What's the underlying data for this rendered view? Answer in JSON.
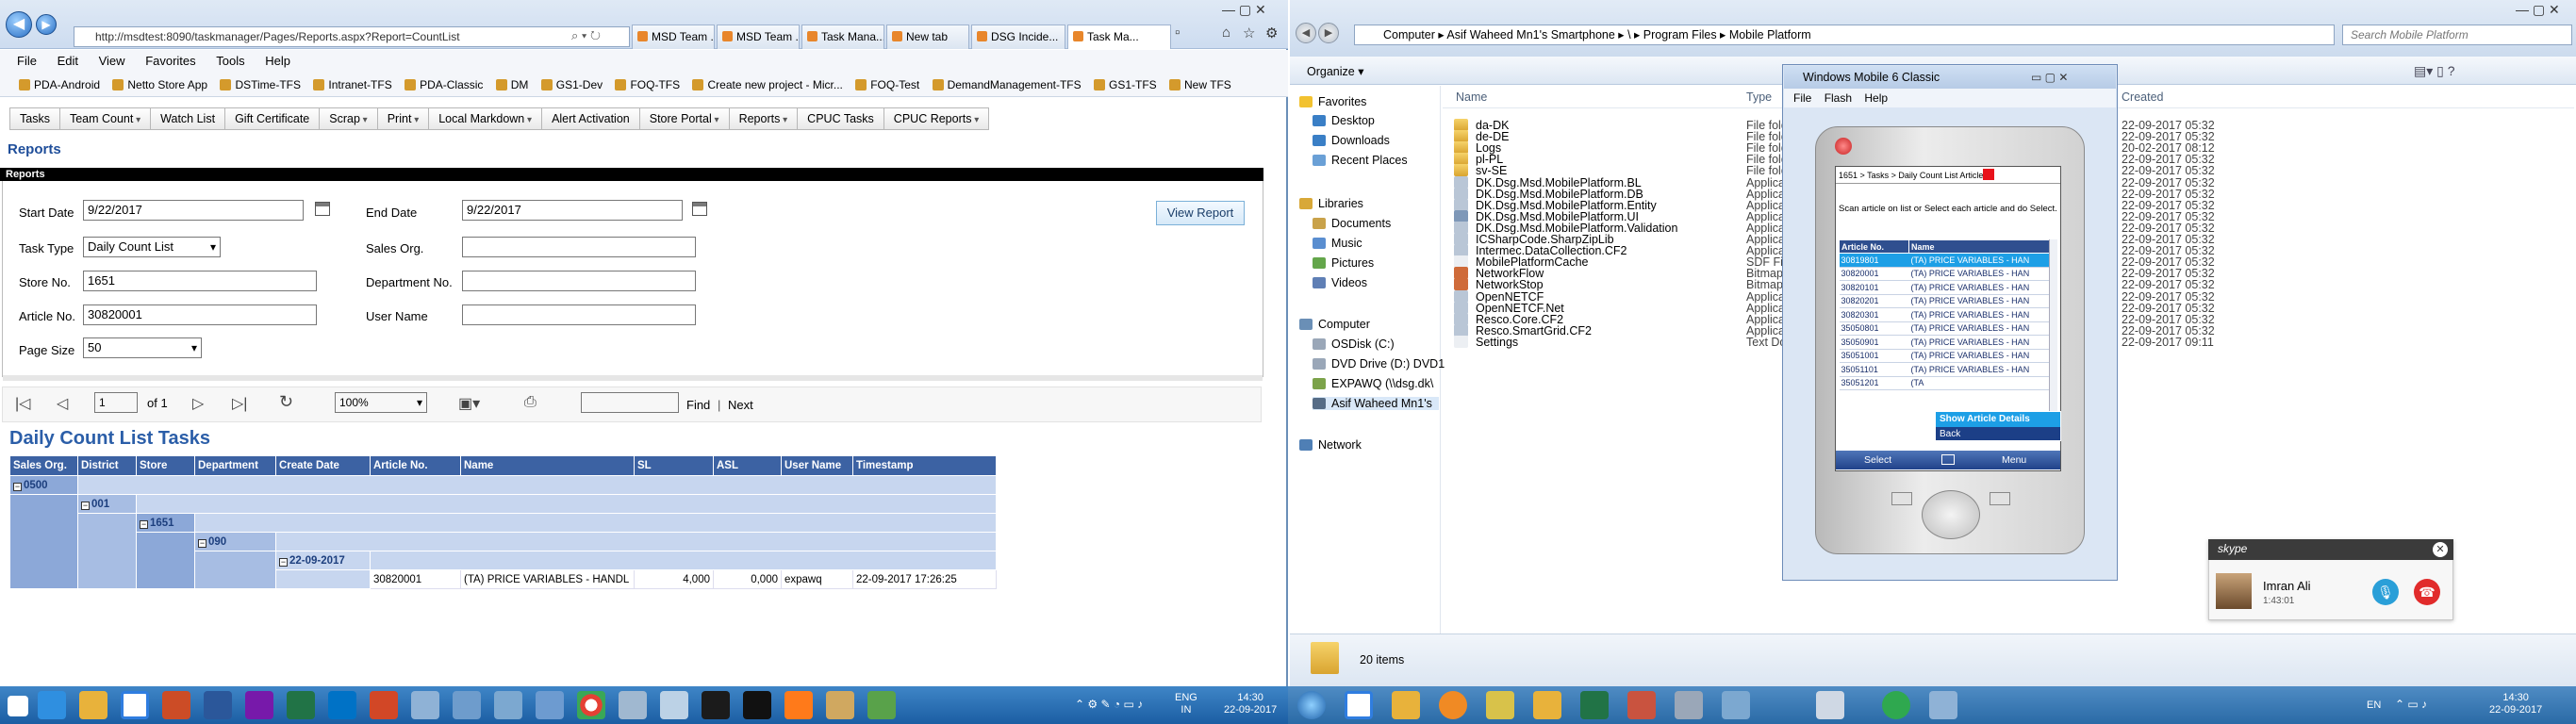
{
  "ie": {
    "url": "http://msdtest:8090/taskmanager/Pages/Reports.aspx?Report=CountList",
    "tabs": [
      "MSD Team ...",
      "MSD Team ...",
      "Task Mana...",
      "New tab",
      "DSG Incide...",
      "Task Ma..."
    ],
    "menu": [
      "File",
      "Edit",
      "View",
      "Favorites",
      "Tools",
      "Help"
    ],
    "favorites": [
      "PDA-Android",
      "Netto Store App",
      "DSTime-TFS",
      "Intranet-TFS",
      "PDA-Classic",
      "DM",
      "GS1-Dev",
      "FOQ-TFS",
      "Create new project - Micr...",
      "FOQ-Test",
      "DemandManagement-TFS",
      "GS1-TFS",
      "New TFS"
    ]
  },
  "appnav": [
    {
      "label": "Tasks",
      "dd": false
    },
    {
      "label": "Team Count",
      "dd": true
    },
    {
      "label": "Watch List",
      "dd": false
    },
    {
      "label": "Gift Certificate",
      "dd": false
    },
    {
      "label": "Scrap",
      "dd": true
    },
    {
      "label": "Print",
      "dd": true
    },
    {
      "label": "Local Markdown",
      "dd": true
    },
    {
      "label": "Alert Activation",
      "dd": false
    },
    {
      "label": "Store Portal",
      "dd": true
    },
    {
      "label": "Reports",
      "dd": true
    },
    {
      "label": "CPUC Tasks",
      "dd": false
    },
    {
      "label": "CPUC Reports",
      "dd": true
    }
  ],
  "reports": {
    "heading": "Reports",
    "bar_title": "Reports",
    "start_date_label": "Start Date",
    "start_date": "9/22/2017",
    "end_date_label": "End Date",
    "end_date": "9/22/2017",
    "task_type_label": "Task Type",
    "task_type": "Daily Count List",
    "sales_org_label": "Sales Org.",
    "store_no_label": "Store No.",
    "store_no": "1651",
    "department_label": "Department No.",
    "article_label": "Article No.",
    "article_no": "30820001",
    "user_name_label": "User Name",
    "page_size_label": "Page Size",
    "page_size": "50",
    "view_report": "View Report"
  },
  "viewer": {
    "page": "1",
    "of_pages": "of 1",
    "zoom": "100%",
    "find": "Find",
    "separator": "|",
    "next": "Next"
  },
  "tasks": {
    "title": "Daily Count List Tasks",
    "headers": [
      "Sales Org.",
      "District",
      "Store",
      "Department",
      "Create Date",
      "Article No.",
      "Name",
      "SL",
      "ASL",
      "User Name",
      "Timestamp"
    ],
    "groups": {
      "sales_org": "0500",
      "district": "001",
      "store": "1651",
      "department": "090",
      "create_date": "22-09-2017"
    },
    "row": {
      "article": "30820001",
      "name": "(TA) PRICE VARIABLES - HANDL",
      "sl": "4,000",
      "asl": "0,000",
      "user": "expawq",
      "timestamp": "22-09-2017 17:26:25"
    }
  },
  "explorer": {
    "breadcrumb": [
      "Computer",
      "Asif Waheed Mn1's Smartphone",
      "\\",
      "Program Files",
      "Mobile Platform"
    ],
    "search_placeholder": "Search Mobile Platform",
    "organize": "Organize",
    "nav": {
      "favorites": "Favorites",
      "fav_items": [
        "Desktop",
        "Downloads",
        "Recent Places"
      ],
      "libraries": "Libraries",
      "lib_items": [
        "Documents",
        "Music",
        "Pictures",
        "Videos"
      ],
      "computer": "Computer",
      "comp_items": [
        "OSDisk (C:)",
        "DVD Drive (D:) DVD1",
        "EXPAWQ (\\\\dsg.dk\\",
        "Asif Waheed Mn1's"
      ],
      "network": "Network"
    },
    "columns": {
      "name": "Name",
      "type": "Type",
      "created": "Created"
    },
    "files": [
      {
        "name": "da-DK",
        "type": "File fold",
        "date": "22-09-2017 05:32",
        "kind": "folder"
      },
      {
        "name": "de-DE",
        "type": "File fold",
        "date": "22-09-2017 05:32",
        "kind": "folder"
      },
      {
        "name": "Logs",
        "type": "File fold",
        "date": "20-02-2017 08:12",
        "kind": "folder"
      },
      {
        "name": "pl-PL",
        "type": "File fold",
        "date": "22-09-2017 05:32",
        "kind": "folder"
      },
      {
        "name": "sv-SE",
        "type": "File fold",
        "date": "22-09-2017 05:32",
        "kind": "folder"
      },
      {
        "name": "DK.Dsg.Msd.MobilePlatform.BL",
        "type": "Applicat",
        "date": "22-09-2017 05:32",
        "kind": "app"
      },
      {
        "name": "DK.Dsg.Msd.MobilePlatform.DB",
        "type": "Applicat",
        "date": "22-09-2017 05:32",
        "kind": "app"
      },
      {
        "name": "DK.Dsg.Msd.MobilePlatform.Entity",
        "type": "Applicat",
        "date": "22-09-2017 05:32",
        "kind": "app"
      },
      {
        "name": "DK.Dsg.Msd.MobilePlatform.UI",
        "type": "Applicat",
        "date": "22-09-2017 05:32",
        "kind": "exe"
      },
      {
        "name": "DK.Dsg.Msd.MobilePlatform.Validation",
        "type": "Applicat",
        "date": "22-09-2017 05:32",
        "kind": "app"
      },
      {
        "name": "ICSharpCode.SharpZipLib",
        "type": "Applicat",
        "date": "22-09-2017 05:32",
        "kind": "app"
      },
      {
        "name": "Intermec.DataCollection.CF2",
        "type": "Applicat",
        "date": "22-09-2017 05:32",
        "kind": "app"
      },
      {
        "name": "MobilePlatformCache",
        "type": "SDF File",
        "date": "22-09-2017 05:32",
        "kind": "file"
      },
      {
        "name": "NetworkFlow",
        "type": "Bitmap i",
        "date": "22-09-2017 05:32",
        "kind": "bmp"
      },
      {
        "name": "NetworkStop",
        "type": "Bitmap i",
        "date": "22-09-2017 05:32",
        "kind": "bmp"
      },
      {
        "name": "OpenNETCF",
        "type": "Applicat",
        "date": "22-09-2017 05:32",
        "kind": "app"
      },
      {
        "name": "OpenNETCF.Net",
        "type": "Applicat",
        "date": "22-09-2017 05:32",
        "kind": "app"
      },
      {
        "name": "Resco.Core.CF2",
        "type": "Applicat",
        "date": "22-09-2017 05:32",
        "kind": "app"
      },
      {
        "name": "Resco.SmartGrid.CF2",
        "type": "Applicat",
        "date": "22-09-2017 05:32",
        "kind": "app"
      },
      {
        "name": "Settings",
        "type": "Text Doc",
        "date": "22-09-2017 09:11",
        "kind": "file"
      }
    ],
    "status": "20 items"
  },
  "wm": {
    "title": "Windows Mobile 6 Classic",
    "menu": [
      "File",
      "Flash",
      "Help"
    ],
    "breadcrumb": "1651 > Tasks > Daily Count List Article",
    "instruction": "Scan article on list or Select each article and do Select.",
    "headers": [
      "Article No.",
      "Name"
    ],
    "rows": [
      {
        "no": "30819801",
        "name": "(TA) PRICE VARIABLES - HAN",
        "sel": true
      },
      {
        "no": "30820001",
        "name": "(TA) PRICE VARIABLES - HAN",
        "sel": false
      },
      {
        "no": "30820101",
        "name": "(TA) PRICE VARIABLES - HAN",
        "sel": false
      },
      {
        "no": "30820201",
        "name": "(TA) PRICE VARIABLES - HAN",
        "sel": false
      },
      {
        "no": "30820301",
        "name": "(TA) PRICE VARIABLES - HAN",
        "sel": false
      },
      {
        "no": "35050801",
        "name": "(TA) PRICE VARIABLES - HAN",
        "sel": false
      },
      {
        "no": "35050901",
        "name": "(TA) PRICE VARIABLES - HAN",
        "sel": false
      },
      {
        "no": "35051001",
        "name": "(TA) PRICE VARIABLES - HAN",
        "sel": false
      },
      {
        "no": "35051101",
        "name": "(TA) PRICE VARIABLES - HAN",
        "sel": false
      },
      {
        "no": "35051201",
        "name": "(TA",
        "sel": false
      }
    ],
    "ctx_show": "Show Article Details",
    "ctx_back": "Back",
    "soft_left": "Select",
    "soft_right": "Menu"
  },
  "skype": {
    "brand": "skype",
    "caller": "Imran Ali",
    "duration": "1:43:01"
  },
  "taskbar": {
    "left_lang": "ENG",
    "left_region": "IN",
    "left_time": "14:30",
    "left_date": "22-09-2017",
    "right_lang": "EN",
    "right_time": "14:30",
    "right_date": "22-09-2017"
  }
}
